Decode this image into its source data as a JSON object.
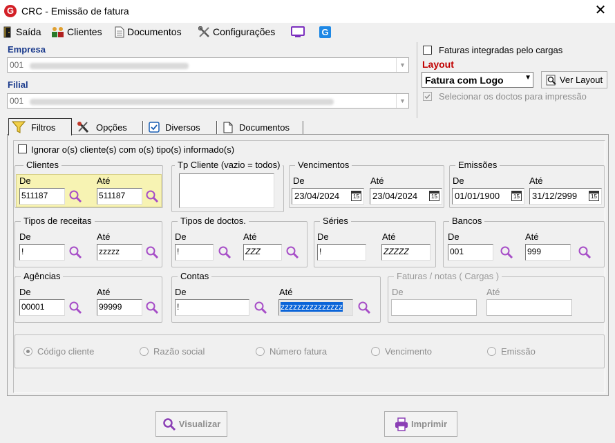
{
  "window": {
    "title": "CRC - Emissão de fatura",
    "app_icon": "G",
    "close": "✕"
  },
  "menu": [
    {
      "label": "Saída",
      "icon": "exit-door-icon"
    },
    {
      "label": "Clientes",
      "icon": "users-icon"
    },
    {
      "label": "Documentos",
      "icon": "document-icon"
    },
    {
      "label": "Configurações",
      "icon": "tools-icon"
    },
    {
      "label": "",
      "icon": "monitor-icon"
    },
    {
      "label": "",
      "icon": "app-logo-icon"
    }
  ],
  "empresa": {
    "label": "Empresa",
    "value": "001"
  },
  "filial": {
    "label": "Filial",
    "value": "001"
  },
  "faturas_integradas": {
    "label": "Faturas integradas pelo cargas",
    "checked": false
  },
  "layout": {
    "label": "Layout",
    "value": "Fatura com Logo",
    "ver_layout": "Ver Layout"
  },
  "selecionar_doctos": {
    "label": "Selecionar os doctos para impressão",
    "checked": true,
    "enabled": false
  },
  "tabs": [
    {
      "label": "Filtros",
      "active": true
    },
    {
      "label": "Opções",
      "active": false
    },
    {
      "label": "Diversos",
      "active": false
    },
    {
      "label": "Documentos",
      "active": false
    }
  ],
  "ignorar": {
    "label": "Ignorar o(s) cliente(s) com o(s) tipo(s) informado(s)",
    "checked": false
  },
  "common": {
    "de": "De",
    "ate": "Até"
  },
  "clientes": {
    "title": "Clientes",
    "de": "511187",
    "ate": "511187"
  },
  "tp_cliente": {
    "title": "Tp Cliente (vazio = todos)",
    "value": ""
  },
  "vencimentos": {
    "title": "Vencimentos",
    "de": "23/04/2024",
    "ate": "23/04/2024",
    "cal": "15"
  },
  "emissoes": {
    "title": "Emissões",
    "de": "01/01/1900",
    "ate": "31/12/2999",
    "cal": "15"
  },
  "tipos_receitas": {
    "title": "Tipos de receitas",
    "de": "!",
    "ate": "zzzzz"
  },
  "tipos_doctos": {
    "title": "Tipos de doctos.",
    "de": "!",
    "ate": "ZZZ"
  },
  "series": {
    "title": "Séries",
    "de": "!",
    "ate": "ZZZZZ"
  },
  "bancos": {
    "title": "Bancos",
    "de": "001",
    "ate": "999"
  },
  "agencias": {
    "title": "Agências",
    "de": "00001",
    "ate": "99999"
  },
  "contas": {
    "title": "Contas",
    "de": "!",
    "ate": "zzzzzzzzzzzzzzz"
  },
  "faturas_notas": {
    "title": "Faturas / notas ( Cargas )",
    "de": "",
    "ate": ""
  },
  "ordem": [
    {
      "label": "Código cliente",
      "selected": true
    },
    {
      "label": "Razão social",
      "selected": false
    },
    {
      "label": "Número fatura",
      "selected": false
    },
    {
      "label": "Vencimento",
      "selected": false
    },
    {
      "label": "Emissão",
      "selected": false
    }
  ],
  "buttons": {
    "visualizar": "Visualizar",
    "imprimir": "Imprimir"
  },
  "colors": {
    "accent_magnifier": "#a64dc7",
    "label_blue": "#1a3a8c",
    "label_red": "#c00000",
    "highlight": "#f7f3b3"
  }
}
